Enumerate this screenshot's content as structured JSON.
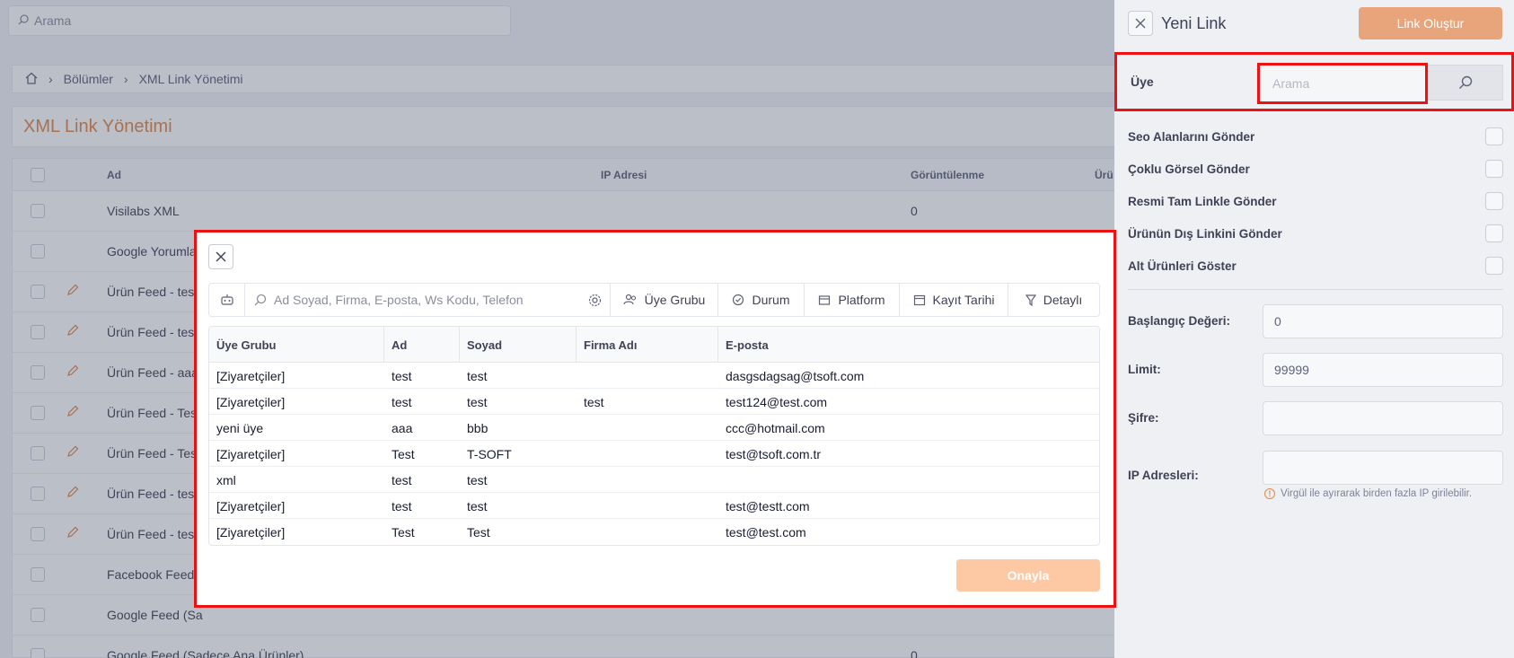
{
  "background": {
    "search_placeholder": "Arama",
    "breadcrumb": [
      "Bölümler",
      "XML Link Yönetimi"
    ],
    "page_title": "XML Link Yönetimi",
    "table_headers": [
      "Ad",
      "IP Adresi",
      "Görüntülenme",
      "Ürü"
    ],
    "rows": [
      {
        "name": "Visilabs XML",
        "views": "0",
        "editable": false
      },
      {
        "name": "Google Yorumla",
        "views": "",
        "editable": false
      },
      {
        "name": "Ürün Feed - test",
        "views": "",
        "editable": true
      },
      {
        "name": "Ürün Feed - test",
        "views": "",
        "editable": true
      },
      {
        "name": "Ürün Feed - aaa",
        "views": "",
        "editable": true
      },
      {
        "name": "Ürün Feed - Tes",
        "views": "",
        "editable": true
      },
      {
        "name": "Ürün Feed - Tes",
        "views": "",
        "editable": true
      },
      {
        "name": "Ürün Feed - test",
        "views": "",
        "editable": true
      },
      {
        "name": "Ürün Feed - tes",
        "views": "",
        "editable": true
      },
      {
        "name": "Facebook Feed",
        "views": "",
        "editable": false
      },
      {
        "name": "Google Feed (Sa",
        "views": "",
        "editable": false
      },
      {
        "name": "Google Feed (Sadece Ana Ürünler)",
        "views": "0",
        "editable": false
      }
    ]
  },
  "drawer": {
    "title": "Yeni Link",
    "create_button": "Link Oluştur",
    "member_label": "Üye",
    "member_placeholder": "Arama",
    "options": [
      "Seo Alanlarını Gönder",
      "Çoklu Görsel Gönder",
      "Resmi Tam Linkle Gönder",
      "Ürünün Dış Linkini Gönder",
      "Alt Ürünleri Göster"
    ],
    "start_label": "Başlangıç Değeri:",
    "start_value": "0",
    "limit_label": "Limit:",
    "limit_value": "99999",
    "password_label": "Şifre:",
    "password_value": "",
    "ip_label": "IP Adresleri:",
    "ip_value": "",
    "ip_hint": "Virgül ile ayırarak birden fazla IP girilebilir."
  },
  "modal": {
    "search_placeholder": "Ad Soyad, Firma, E-posta, Ws Kodu, Telefon",
    "filters": [
      "Üye Grubu",
      "Durum",
      "Platform",
      "Kayıt Tarihi",
      "Detaylı"
    ],
    "columns": [
      "Üye Grubu",
      "Ad",
      "Soyad",
      "Firma Adı",
      "E-posta"
    ],
    "rows": [
      [
        "[Ziyaretçiler]",
        "test",
        "test",
        "",
        "dasgsdagsag@tsoft.com"
      ],
      [
        "[Ziyaretçiler]",
        "test",
        "test",
        "test",
        "test124@test.com"
      ],
      [
        "yeni üye",
        "aaa",
        "bbb",
        "",
        "ccc@hotmail.com"
      ],
      [
        "[Ziyaretçiler]",
        "Test",
        "T-SOFT",
        "",
        "test@tsoft.com.tr"
      ],
      [
        "xml",
        "test",
        "test",
        "",
        ""
      ],
      [
        "[Ziyaretçiler]",
        "test",
        "test",
        "",
        "test@testt.com"
      ],
      [
        "[Ziyaretçiler]",
        "Test",
        "Test",
        "",
        "test@test.com"
      ]
    ],
    "approve_button": "Onayla"
  }
}
